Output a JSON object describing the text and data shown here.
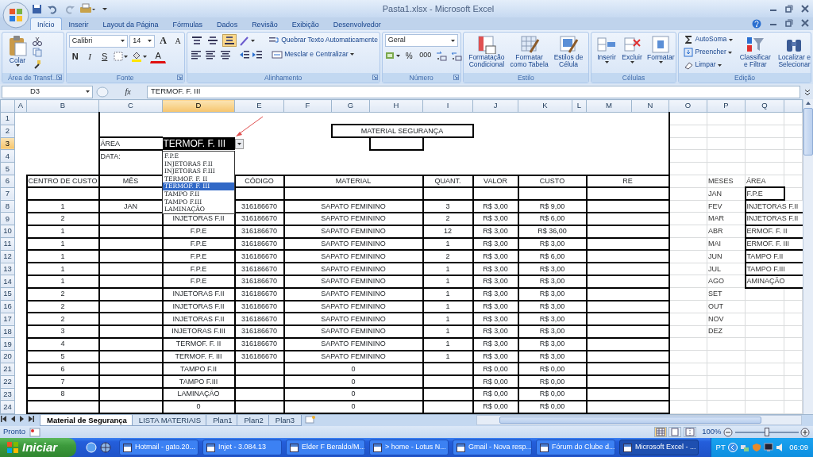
{
  "window": {
    "title": "Pasta1.xlsx - Microsoft Excel"
  },
  "tabs": [
    {
      "label": "Início",
      "selected": true
    },
    {
      "label": "Inserir",
      "selected": false
    },
    {
      "label": "Layout da Página",
      "selected": false
    },
    {
      "label": "Fórmulas",
      "selected": false
    },
    {
      "label": "Dados",
      "selected": false
    },
    {
      "label": "Revisão",
      "selected": false
    },
    {
      "label": "Exibição",
      "selected": false
    },
    {
      "label": "Desenvolvedor",
      "selected": false
    }
  ],
  "ribbon": {
    "clipboard": {
      "paste": "Colar",
      "label": "Área de Transf..."
    },
    "font": {
      "family": "Calibri",
      "size": "14",
      "grow": "A",
      "shrink": "A",
      "bold": "N",
      "italic": "I",
      "underline": "S",
      "font_color_letter": "A",
      "label": "Fonte"
    },
    "alignment": {
      "vertical": [
        {
          "kind": "top",
          "selected": false
        },
        {
          "kind": "middle",
          "selected": false
        },
        {
          "kind": "bottom",
          "selected": true
        }
      ],
      "wrap": "Quebrar Texto Automaticamente",
      "merge": "Mesclar e Centralizar",
      "label": "Alinhamento"
    },
    "number": {
      "format": "Geral",
      "percent": "%",
      "thousands": "000",
      "label": "Número"
    },
    "styles": {
      "buttons": [
        {
          "lines": [
            "Formatação",
            "Condicional"
          ]
        },
        {
          "lines": [
            "Formatar",
            "como Tabela"
          ]
        },
        {
          "lines": [
            "Estilos de",
            "Célula"
          ]
        }
      ],
      "label": "Estilo"
    },
    "cells": {
      "buttons": [
        {
          "lines": [
            "Inserir"
          ]
        },
        {
          "lines": [
            "Excluir"
          ]
        },
        {
          "lines": [
            "Formatar"
          ]
        }
      ],
      "label": "Células"
    },
    "editing": {
      "small": [
        {
          "label": "AutoSoma"
        },
        {
          "label": "Preencher"
        },
        {
          "label": "Limpar"
        }
      ],
      "buttons": [
        {
          "lines": [
            "Classificar",
            "e Filtrar"
          ]
        },
        {
          "lines": [
            "Localizar e",
            "Selecionar"
          ]
        }
      ],
      "label": "Edição"
    }
  },
  "formula_bar": {
    "name_box": "D3",
    "function_label": "fx",
    "formula": "TERMOF. F. III"
  },
  "sheet": {
    "columns": [
      {
        "label": "A",
        "selected": false
      },
      {
        "label": "B",
        "selected": false
      },
      {
        "label": "C",
        "selected": false
      },
      {
        "label": "D",
        "selected": true
      },
      {
        "label": "E",
        "selected": false
      },
      {
        "label": "F",
        "selected": false
      },
      {
        "label": "G",
        "selected": false
      },
      {
        "label": "H",
        "selected": false
      },
      {
        "label": "I",
        "selected": false
      },
      {
        "label": "J",
        "selected": false
      },
      {
        "label": "K",
        "selected": false
      },
      {
        "label": "L",
        "selected": false
      },
      {
        "label": "M",
        "selected": false
      },
      {
        "label": "N",
        "selected": false
      },
      {
        "label": "O",
        "selected": false
      },
      {
        "label": "P",
        "selected": false
      },
      {
        "label": "Q",
        "selected": false
      }
    ],
    "rows": [
      {
        "number": "1",
        "selected": false
      },
      {
        "number": "2",
        "selected": false
      },
      {
        "number": "3",
        "selected": true
      },
      {
        "number": "4",
        "selected": false
      },
      {
        "number": "5",
        "selected": false
      },
      {
        "number": "6",
        "selected": false
      },
      {
        "number": "7",
        "selected": false
      },
      {
        "number": "8",
        "selected": false
      },
      {
        "number": "9",
        "selected": false
      },
      {
        "number": "10",
        "selected": false
      },
      {
        "number": "11",
        "selected": false
      },
      {
        "number": "12",
        "selected": false
      },
      {
        "number": "13",
        "selected": false
      },
      {
        "number": "14",
        "selected": false
      },
      {
        "number": "15",
        "selected": false
      },
      {
        "number": "16",
        "selected": false
      },
      {
        "number": "17",
        "selected": false
      },
      {
        "number": "18",
        "selected": false
      },
      {
        "number": "19",
        "selected": false
      },
      {
        "number": "20",
        "selected": false
      },
      {
        "number": "21",
        "selected": false
      },
      {
        "number": "22",
        "selected": false
      },
      {
        "number": "23",
        "selected": false
      },
      {
        "number": "24",
        "selected": false
      }
    ],
    "title": "MATERIAL SEGURANÇA",
    "form": [
      {
        "label": "ÁREA",
        "value": "TERMOF. F. III"
      },
      {
        "label": "DATA:"
      }
    ],
    "table": {
      "headers": {
        "centro": "CENTRO DE CUSTO",
        "mes": "MÊS",
        "codigo": "CÓDIGO",
        "material": "MATERIAL",
        "quant": "QUANT.",
        "valor": "VALOR",
        "custo": "CUSTO",
        "re": "RE"
      },
      "records": [
        {
          "centro": "1",
          "mes": "JAN",
          "codigo": "316186670",
          "material": "SAPATO FEMININO",
          "quant": "3",
          "valor": "R$ 3,00",
          "custo": "R$ 9,00"
        },
        {
          "centro": "2",
          "area": "INJETORAS F.II",
          "codigo": "316186670",
          "material": "SAPATO FEMININO",
          "quant": "2",
          "valor": "R$ 3,00",
          "custo": "R$ 6,00"
        },
        {
          "centro": "1",
          "area": "F.P.E",
          "codigo": "316186670",
          "material": "SAPATO FEMININO",
          "quant": "12",
          "valor": "R$ 3,00",
          "custo": "R$ 36,00"
        },
        {
          "centro": "1",
          "area": "F.P.E",
          "codigo": "316186670",
          "material": "SAPATO FEMININO",
          "quant": "1",
          "valor": "R$ 3,00",
          "custo": "R$ 3,00"
        },
        {
          "centro": "1",
          "area": "F.P.E",
          "codigo": "316186670",
          "material": "SAPATO FEMININO",
          "quant": "2",
          "valor": "R$ 3,00",
          "custo": "R$ 6,00"
        },
        {
          "centro": "1",
          "area": "F.P.E",
          "codigo": "316186670",
          "material": "SAPATO FEMININO",
          "quant": "1",
          "valor": "R$ 3,00",
          "custo": "R$ 3,00"
        },
        {
          "centro": "1",
          "area": "F.P.E",
          "codigo": "316186670",
          "material": "SAPATO FEMININO",
          "quant": "1",
          "valor": "R$ 3,00",
          "custo": "R$ 3,00"
        },
        {
          "centro": "2",
          "area": "INJETORAS F.II",
          "codigo": "316186670",
          "material": "SAPATO FEMININO",
          "quant": "1",
          "valor": "R$ 3,00",
          "custo": "R$ 3,00"
        },
        {
          "centro": "2",
          "area": "INJETORAS F.II",
          "codigo": "316186670",
          "material": "SAPATO FEMININO",
          "quant": "1",
          "valor": "R$ 3,00",
          "custo": "R$ 3,00"
        },
        {
          "centro": "2",
          "area": "INJETORAS F.II",
          "codigo": "316186670",
          "material": "SAPATO FEMININO",
          "quant": "1",
          "valor": "R$ 3,00",
          "custo": "R$ 3,00"
        },
        {
          "centro": "3",
          "area": "INJETORAS F.III",
          "codigo": "316186670",
          "material": "SAPATO FEMININO",
          "quant": "1",
          "valor": "R$ 3,00",
          "custo": "R$ 3,00"
        },
        {
          "centro": "4",
          "area": "TERMOF. F. II",
          "codigo": "316186670",
          "material": "SAPATO FEMININO",
          "quant": "1",
          "valor": "R$ 3,00",
          "custo": "R$ 3,00"
        },
        {
          "centro": "5",
          "area": "TERMOF. F. III",
          "codigo": "316186670",
          "material": "SAPATO FEMININO",
          "quant": "1",
          "valor": "R$ 3,00",
          "custo": "R$ 3,00"
        },
        {
          "centro": "6",
          "area": "TAMPO F.II",
          "material": "0",
          "valor": "R$ 0,00",
          "custo": "R$ 0,00"
        },
        {
          "centro": "7",
          "area": "TAMPO F.III",
          "material": "0",
          "valor": "R$ 0,00",
          "custo": "R$ 0,00"
        },
        {
          "centro": "8",
          "area": "LAMINAÇÃO",
          "material": "0",
          "valor": "R$ 0,00",
          "custo": "R$ 0,00"
        },
        {
          "area": "0",
          "material": "0",
          "valor": "R$ 0,00",
          "custo": "R$ 0,00"
        }
      ]
    },
    "lookup": {
      "months_header": "MESES",
      "areas_header": "ÁREA",
      "months": [
        "JAN",
        "FEV",
        "MAR",
        "ABR",
        "MAI",
        "JUN",
        "JUL",
        "AGO",
        "SET",
        "OUT",
        "NOV",
        "DEZ"
      ],
      "areas": [
        "F.P.E",
        "INJETORAS F.II",
        "INJETORAS F.II",
        "ERMOF. F. II",
        "ERMOF. F. III",
        "TAMPO F.II",
        "TAMPO F.III",
        "AMINAÇÃO"
      ]
    },
    "dropdown": {
      "items": [
        {
          "label": "F.P.E",
          "selected": false
        },
        {
          "label": "INJETORAS F.II",
          "selected": false
        },
        {
          "label": "INJETORAS F.III",
          "selected": false
        },
        {
          "label": "TERMOF. F. II",
          "selected": false
        },
        {
          "label": "TERMOF. F. III",
          "selected": true
        },
        {
          "label": "TAMPO F.II",
          "selected": false
        },
        {
          "label": "TAMPO F.III",
          "selected": false
        },
        {
          "label": "LAMINAÇÃO",
          "selected": false
        }
      ]
    }
  },
  "sheet_tabs": [
    {
      "label": "Material de Segurança",
      "selected": true
    },
    {
      "label": "LISTA MATERIAIS",
      "selected": false
    },
    {
      "label": "Plan1",
      "selected": false
    },
    {
      "label": "Plan2",
      "selected": false
    },
    {
      "label": "Plan3",
      "selected": false
    }
  ],
  "status_bar": {
    "text": "Pronto",
    "views": [
      {
        "kind": "normal",
        "selected": true
      },
      {
        "kind": "layout",
        "selected": false
      },
      {
        "kind": "break",
        "selected": false
      }
    ],
    "zoom": "100%",
    "zoom_slider": {
      "level": 0.5
    }
  },
  "taskbar": {
    "start": "Iniciar",
    "tasks": [
      {
        "label": "Hotmail - gato.20...",
        "selected": false
      },
      {
        "label": "Injet - 3.084.13",
        "selected": false
      },
      {
        "label": "Elder F Beraldo/M...",
        "selected": false
      },
      {
        "label": "> home - Lotus N...",
        "selected": false
      },
      {
        "label": "Gmail - Nova resp...",
        "selected": false
      },
      {
        "label": "Fórum do Clube d...",
        "selected": false
      },
      {
        "label": "Microsoft Excel - ...",
        "selected": true
      }
    ],
    "language": "PT",
    "clock": "06:09"
  }
}
